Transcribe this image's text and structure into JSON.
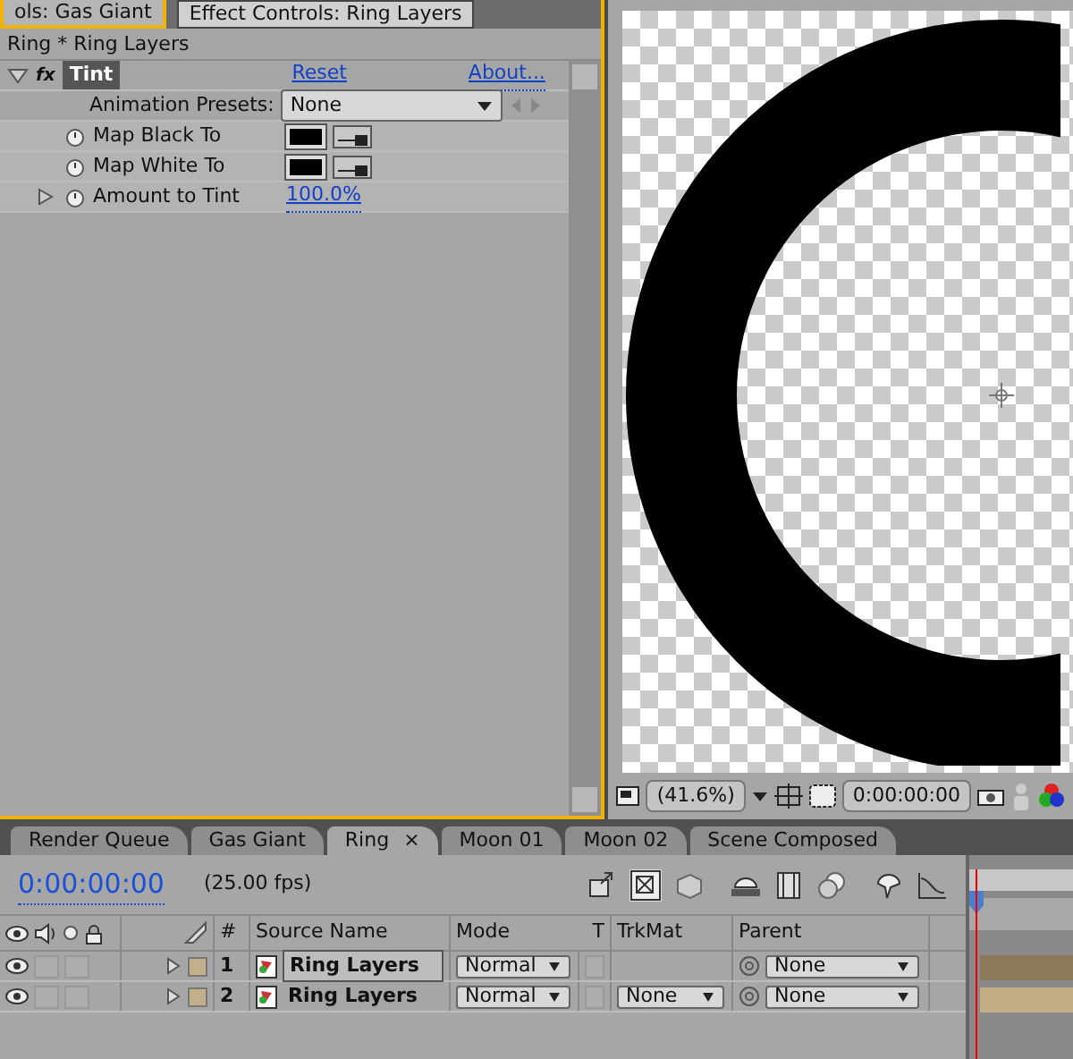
{
  "panel_tabs": [
    {
      "label": "ols: Gas Giant",
      "selected": false
    },
    {
      "label": "Effect Controls: Ring Layers",
      "selected": true
    }
  ],
  "effect_controls": {
    "title": "Ring * Ring Layers",
    "effect": {
      "badge": "fx",
      "name": "Tint",
      "expanded": true,
      "reset": "Reset",
      "about": "About...",
      "presets_label": "Animation Presets:",
      "presets_value": "None"
    },
    "properties": [
      {
        "kind": "color",
        "name": "Map Black To",
        "color": "#000000"
      },
      {
        "kind": "color",
        "name": "Map White To",
        "color": "#000000"
      },
      {
        "kind": "value",
        "name": "Amount to Tint",
        "value": "100.0%",
        "expanded": false
      }
    ]
  },
  "viewer": {
    "zoom": "(41.6%)",
    "timecode": "0:00:00:00"
  },
  "timeline_tabs": [
    {
      "label": "Render Queue",
      "selected": false
    },
    {
      "label": "Gas Giant",
      "selected": false
    },
    {
      "label": "Ring",
      "selected": true,
      "close": "×"
    },
    {
      "label": "Moon 01",
      "selected": false
    },
    {
      "label": "Moon 02",
      "selected": false
    },
    {
      "label": "Scene Composed",
      "selected": false
    }
  ],
  "timeline": {
    "timecode": "0:00:00:00",
    "fps": "(25.00 fps)",
    "columns": {
      "number": "#",
      "source_name": "Source Name",
      "mode": "Mode",
      "t": "T",
      "trkmat": "TrkMat",
      "parent": "Parent"
    },
    "layers": [
      {
        "number": "1",
        "name": "Ring Layers",
        "selected": true,
        "mode": "Normal",
        "parent": "None"
      },
      {
        "number": "2",
        "name": "Ring Layers",
        "selected": false,
        "mode": "Normal",
        "trkmat": "None",
        "parent": "None"
      }
    ]
  }
}
